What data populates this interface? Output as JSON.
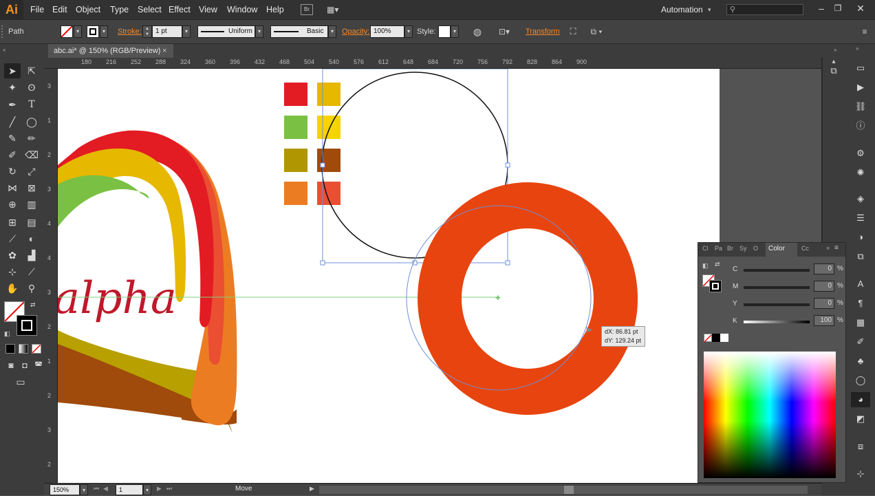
{
  "app": {
    "logo": "Ai"
  },
  "menu": [
    "File",
    "Edit",
    "Object",
    "Type",
    "Select",
    "Effect",
    "View",
    "Window",
    "Help"
  ],
  "workspace": {
    "label": "Automation"
  },
  "control_bar": {
    "selection_type": "Path",
    "stroke_label": "Stroke:",
    "stroke_weight": "1 pt",
    "profile": "Uniform",
    "brush": "Basic",
    "opacity_label": "Opacity:",
    "opacity_value": "100%",
    "style_label": "Style:",
    "transform_label": "Transform"
  },
  "document_tab": {
    "title": "abc.ai* @ 150% (RGB/Preview)",
    "close": "×"
  },
  "ruler_top": [
    "180",
    "216",
    "252",
    "288",
    "324",
    "360",
    "396",
    "432",
    "468",
    "504",
    "540",
    "576",
    "612",
    "648",
    "684",
    "720",
    "756",
    "792",
    "828",
    "864",
    "900"
  ],
  "ruler_left": [
    "3",
    "1",
    "2",
    "3",
    "4",
    "4",
    "3",
    "2",
    "1",
    "2",
    "3",
    "2"
  ],
  "artboard": {
    "alpha_text": "alpha",
    "swatch_colors": [
      "#e31b23",
      "#e6b800",
      "#7ac143",
      "#f5d400",
      "#b09600",
      "#a04a0c",
      "#ec7c22",
      "#ea4f32"
    ],
    "ring_color": "#e8440f",
    "readout_dx": "dX: 86.81 pt",
    "readout_dy": "dY: 129.24 pt"
  },
  "color_panel": {
    "tabs": [
      "Cl",
      "Pa",
      "Br",
      "Sy",
      "O",
      "Color",
      "Cc"
    ],
    "active_tab": "Color",
    "channels": [
      {
        "label": "C",
        "value": "0",
        "unit": "%"
      },
      {
        "label": "M",
        "value": "0",
        "unit": "%"
      },
      {
        "label": "Y",
        "value": "0",
        "unit": "%"
      },
      {
        "label": "K",
        "value": "100",
        "unit": "%"
      }
    ]
  },
  "status_bar": {
    "zoom": "150%",
    "page": "1",
    "tool_status": "Move"
  }
}
